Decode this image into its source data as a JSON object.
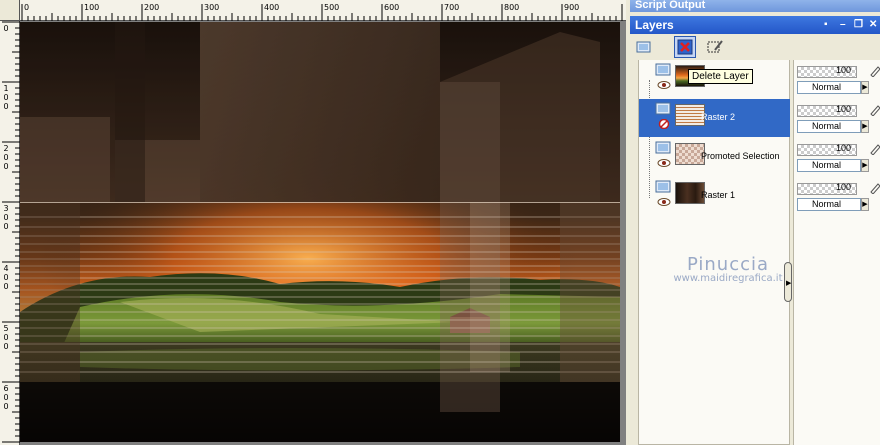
{
  "ruler": {
    "top_labels": [
      "0",
      "100",
      "200",
      "300",
      "400",
      "500",
      "600",
      "700",
      "800",
      "900"
    ],
    "left_labels": [
      [
        "0"
      ],
      [
        "1",
        "0",
        "0"
      ],
      [
        "2",
        "0",
        "0"
      ],
      [
        "3",
        "0",
        "0"
      ],
      [
        "4",
        "0",
        "0"
      ],
      [
        "5",
        "0",
        "0"
      ],
      [
        "6",
        "0",
        "0"
      ]
    ]
  },
  "script_output": {
    "title": "Script Output"
  },
  "layers_panel": {
    "title": "Layers",
    "controls": [
      "pin-icon",
      "minimize-icon",
      "restore-icon",
      "close-icon"
    ],
    "toolbar": [
      "new-layer-icon",
      "delete-layer-icon",
      "edit-selection-icon"
    ],
    "tooltip": "Delete Layer",
    "layers": [
      {
        "name": "",
        "selected": false,
        "thumb": "landscape"
      },
      {
        "name": "Raster 2",
        "selected": true,
        "thumb": "stripes"
      },
      {
        "name": "Promoted Selection",
        "selected": false,
        "thumb": "checker"
      },
      {
        "name": "Raster 1",
        "selected": false,
        "thumb": "dark"
      }
    ],
    "properties": [
      {
        "opacity": "100",
        "blend": "Normal"
      },
      {
        "opacity": "100",
        "blend": "Normal"
      },
      {
        "opacity": "100",
        "blend": "Normal"
      },
      {
        "opacity": "100",
        "blend": "Normal"
      }
    ]
  },
  "watermark": {
    "name": "Pinuccia",
    "url": "www.maidiregrafica.it"
  },
  "colors": {
    "selection": "#3169c6",
    "titlebar": "#2457c8",
    "panel": "#ece9d8"
  }
}
